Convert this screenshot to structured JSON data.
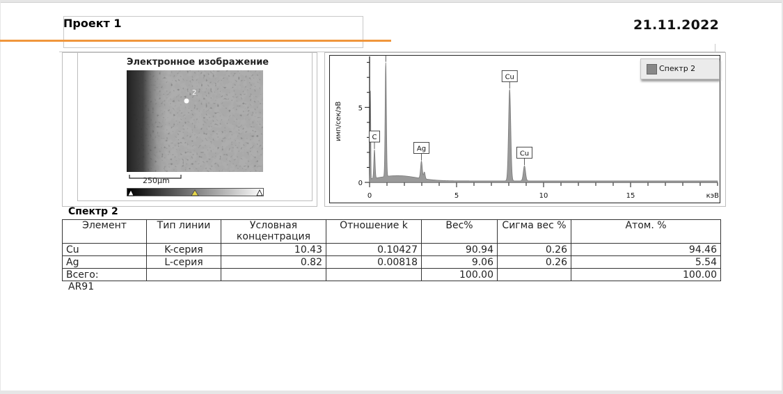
{
  "header": {
    "project_title": "Проект 1",
    "date": "21.11.2022"
  },
  "image_panel": {
    "title": "Электронное изображение",
    "marker_label": "2",
    "scale_bar": "250µm"
  },
  "chart_data": {
    "type": "line",
    "xlabel": "кэВ",
    "ylabel": "имп/сек/эВ",
    "xlim": [
      0,
      20
    ],
    "ylim": [
      0,
      8.4
    ],
    "xticks": [
      0,
      5,
      10,
      15
    ],
    "yticks": [
      0,
      5
    ],
    "legend": "top-right",
    "series": [
      {
        "name": "Спектр 2",
        "color": "#8c8c8c"
      }
    ],
    "peaks": [
      {
        "label": "C",
        "x": 0.28,
        "y": 1.9
      },
      {
        "label": "Cu",
        "x": 0.93,
        "y": 7.6
      },
      {
        "label": "Ag",
        "x": 2.98,
        "y": 1.15
      },
      {
        "label": "Cu",
        "x": 8.05,
        "y": 6.1
      },
      {
        "label": "Cu",
        "x": 8.9,
        "y": 1.0
      }
    ]
  },
  "results": {
    "heading": "Спектр 2",
    "headers": [
      "Элемент",
      "Тип линии",
      "Условная концентрация",
      "Отношение k",
      "Вес%",
      "Сигма вес %",
      "Атом. %"
    ],
    "rows": [
      [
        "Cu",
        "K-серия",
        "10.43",
        "0.10427",
        "90.94",
        "0.26",
        "94.46"
      ],
      [
        "Ag",
        "L-серия",
        "0.82",
        "0.00818",
        "9.06",
        "0.26",
        "5.54"
      ],
      [
        "Всего:",
        "",
        "",
        "",
        "100.00",
        "",
        "100.00"
      ]
    ],
    "sample": "AR91"
  }
}
